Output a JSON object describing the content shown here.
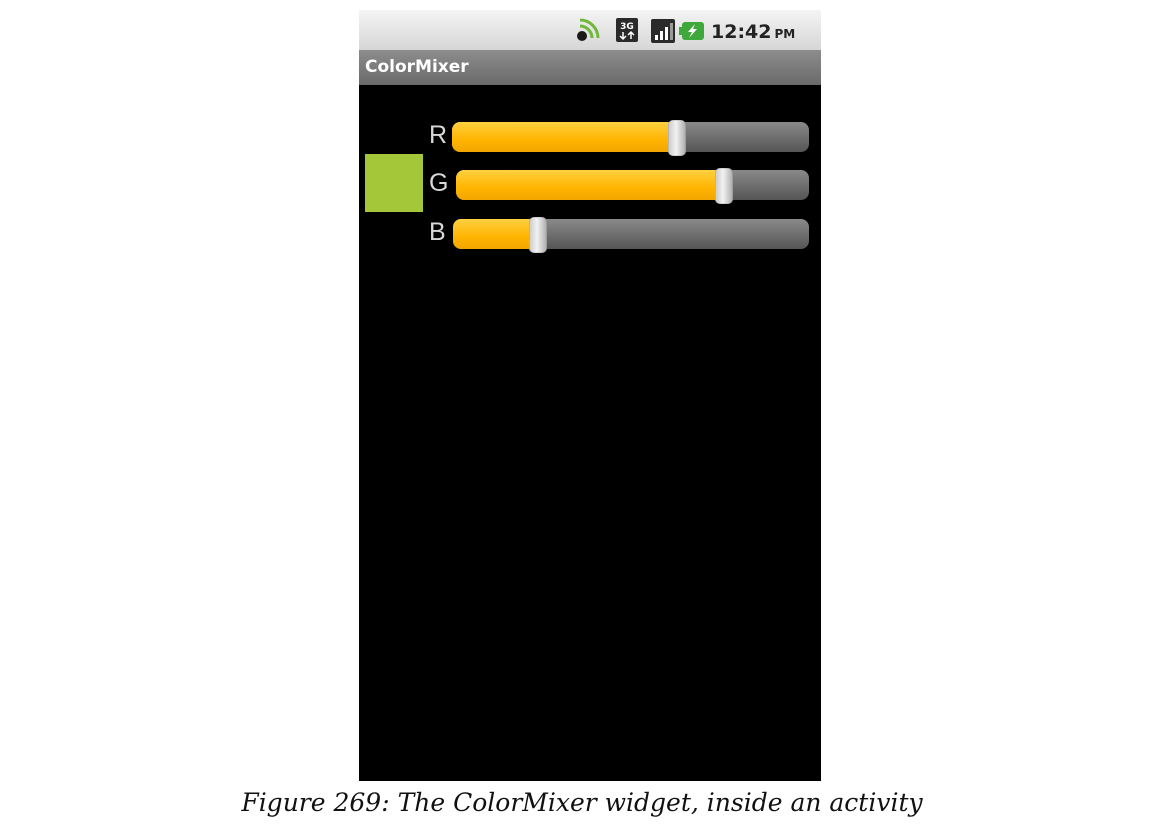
{
  "status_bar": {
    "time": "12:42",
    "ampm": "PM",
    "icons": [
      "wifi-icon",
      "network-3g-icon",
      "signal-icon",
      "battery-charging-icon"
    ]
  },
  "app": {
    "title": "ColorMixer"
  },
  "color_swatch": {
    "color": "#a4c639"
  },
  "sliders": [
    {
      "label": "R",
      "value_fraction": 0.63
    },
    {
      "label": "G",
      "value_fraction": 0.76
    },
    {
      "label": "B",
      "value_fraction": 0.24
    }
  ],
  "caption": "Figure 269: The ColorMixer widget, inside an activity"
}
